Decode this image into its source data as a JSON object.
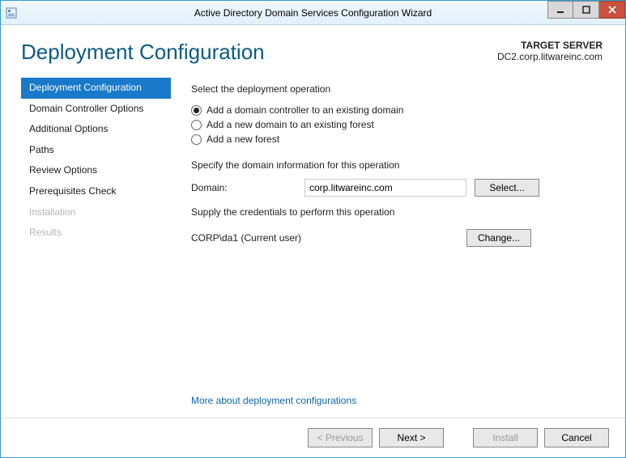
{
  "window": {
    "title": "Active Directory Domain Services Configuration Wizard"
  },
  "header": {
    "page_title": "Deployment Configuration",
    "target_label": "TARGET SERVER",
    "target_value": "DC2.corp.litwareinc.com"
  },
  "sidebar": {
    "items": [
      {
        "label": "Deployment Configuration",
        "state": "selected"
      },
      {
        "label": "Domain Controller Options",
        "state": "enabled"
      },
      {
        "label": "Additional Options",
        "state": "enabled"
      },
      {
        "label": "Paths",
        "state": "enabled"
      },
      {
        "label": "Review Options",
        "state": "enabled"
      },
      {
        "label": "Prerequisites Check",
        "state": "enabled"
      },
      {
        "label": "Installation",
        "state": "disabled"
      },
      {
        "label": "Results",
        "state": "disabled"
      }
    ]
  },
  "main": {
    "op_label": "Select the deployment operation",
    "op_options": [
      "Add a domain controller to an existing domain",
      "Add a new domain to an existing forest",
      "Add a new forest"
    ],
    "op_selected": 0,
    "domain_section_label": "Specify the domain information for this operation",
    "domain_label": "Domain:",
    "domain_value": "corp.litwareinc.com",
    "select_button": "Select...",
    "cred_section_label": "Supply the credentials to perform this operation",
    "cred_value": "CORP\\da1 (Current user)",
    "change_button": "Change...",
    "more_link": "More about deployment configurations"
  },
  "footer": {
    "previous": "< Previous",
    "next": "Next >",
    "install": "Install",
    "cancel": "Cancel"
  }
}
